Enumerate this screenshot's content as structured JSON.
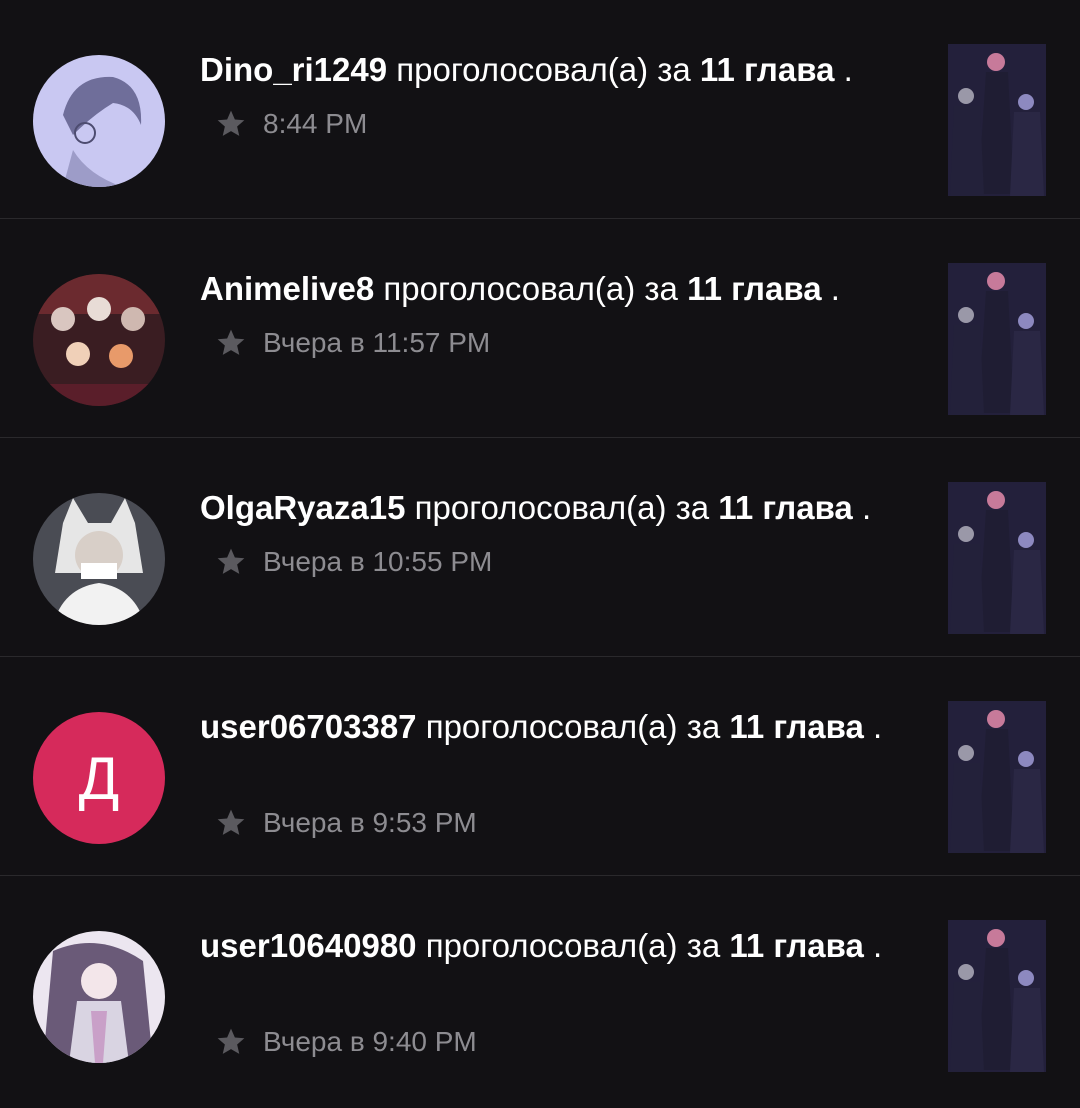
{
  "items": [
    {
      "user": "Dino_ri1249",
      "action": "проголосовал(а) за",
      "chapter": "11 глава",
      "end": ".",
      "time": "8:44 PM",
      "avatar": "sketch"
    },
    {
      "user": "Animelive8",
      "action": "проголосовал(а) за",
      "chapter": "11 глава",
      "end": ".",
      "time": "Вчера в 11:57 PM",
      "avatar": "group"
    },
    {
      "user": "OlgaRyaza15",
      "action": "проголосовал(а) за",
      "chapter": "11 глава",
      "end": ".",
      "time": "Вчера в 10:55 PM",
      "avatar": "mask"
    },
    {
      "user": "user06703387",
      "action": "проголосовал(а) за",
      "chapter": "11 глава",
      "end": ".",
      "time": "Вчера в 9:53 PM",
      "avatar": "letter",
      "letter": "Д"
    },
    {
      "user": "user10640980",
      "action": "проголосовал(а) за",
      "chapter": "11 глава",
      "end": ".",
      "time": "Вчера в 9:40 PM",
      "avatar": "girl"
    }
  ],
  "icons": {
    "star": "star-icon"
  },
  "colors": {
    "background": "#121114",
    "meta_text": "#8d8c91",
    "letter_avatar": "#d62a5b"
  }
}
